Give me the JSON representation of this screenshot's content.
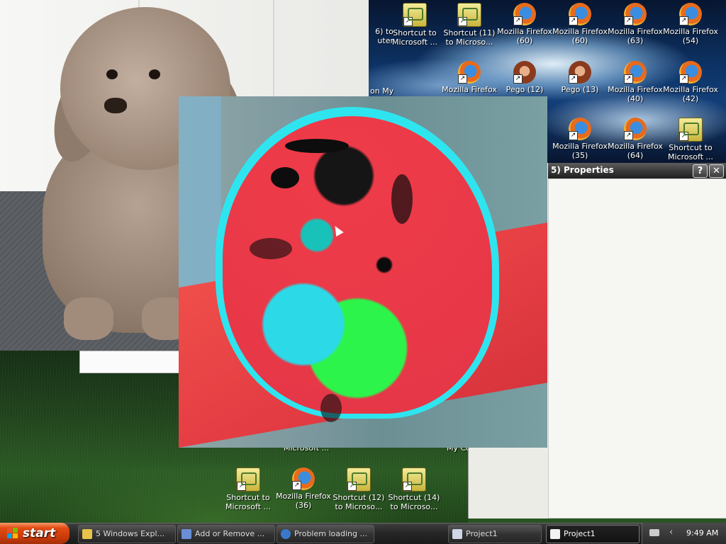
{
  "desktop": {
    "top_icons": [
      {
        "line1": "6) to",
        "line2": "uter",
        "type": "partial"
      },
      {
        "line1": "Shortcut to",
        "line2": "Microsoft ...",
        "type": "shortcut"
      },
      {
        "line1": "Shortcut (11)",
        "line2": "to Microso...",
        "type": "shortcut"
      },
      {
        "line1": "Mozilla Firefox",
        "line2": "(60)",
        "type": "firefox"
      },
      {
        "line1": "Mozilla Firefox",
        "line2": "(60)",
        "type": "firefox"
      },
      {
        "line1": "Mozilla Firefox",
        "line2": "(63)",
        "type": "firefox"
      },
      {
        "line1": "Mozilla Firefox",
        "line2": "(54)",
        "type": "firefox"
      }
    ],
    "row2_icons": [
      {
        "line1": "Mozilla Firefox",
        "line2": "",
        "type": "firefox"
      },
      {
        "line1": "Pego (12)",
        "line2": "",
        "type": "pego"
      },
      {
        "line1": "Pego (13)",
        "line2": "",
        "type": "pego"
      },
      {
        "line1": "Mozilla Firefox",
        "line2": "(40)",
        "type": "firefox"
      },
      {
        "line1": "Mozilla Firefox",
        "line2": "(42)",
        "type": "firefox"
      }
    ],
    "row3_icons": [
      {
        "line1": "Mozilla Firefox",
        "line2": "(35)",
        "type": "firefox"
      },
      {
        "line1": "Mozilla Firefox",
        "line2": "(64)",
        "type": "firefox"
      },
      {
        "line1": "Shortcut to",
        "line2": "Microsoft ...",
        "type": "shortcut"
      }
    ],
    "bottom_icons": [
      {
        "line1": "Shortcut to",
        "line2": "Microsoft ...",
        "type": "shortcut"
      },
      {
        "line1": "Mozilla Firefox",
        "line2": "(36)",
        "type": "firefox"
      },
      {
        "line1": "Shortcut (12)",
        "line2": "to Microso...",
        "type": "shortcut"
      },
      {
        "line1": "Shortcut (14)",
        "line2": "to Microso...",
        "type": "shortcut"
      }
    ],
    "partial_labels": {
      "on_my": "on My",
      "microsoft_partial": "Microsoft ...",
      "my_co": "My Co"
    }
  },
  "properties_window": {
    "title": "5) Properties",
    "help_button": "?",
    "close_button": "✕"
  },
  "taskbar": {
    "start_label": "start",
    "tasks": [
      {
        "label": "5 Windows Expl...",
        "icon_color": "#e8c24a"
      },
      {
        "label": "Add or Remove ...",
        "icon_color": "#6a8fd6"
      },
      {
        "label": "Problem loading ...",
        "icon_color": "#3a79c9"
      },
      {
        "label": "Project1",
        "icon_color": "#cfd6e6"
      },
      {
        "label": "Project1",
        "icon_color": "#f2f2f2"
      }
    ],
    "clock": "9:49 AM"
  },
  "colors": {
    "start_orange": "#e24b12",
    "taskbar_dark": "#262626",
    "psy_red": "#ee3b49",
    "psy_cyan": "#2ee5ef",
    "psy_green": "#2df44a"
  }
}
